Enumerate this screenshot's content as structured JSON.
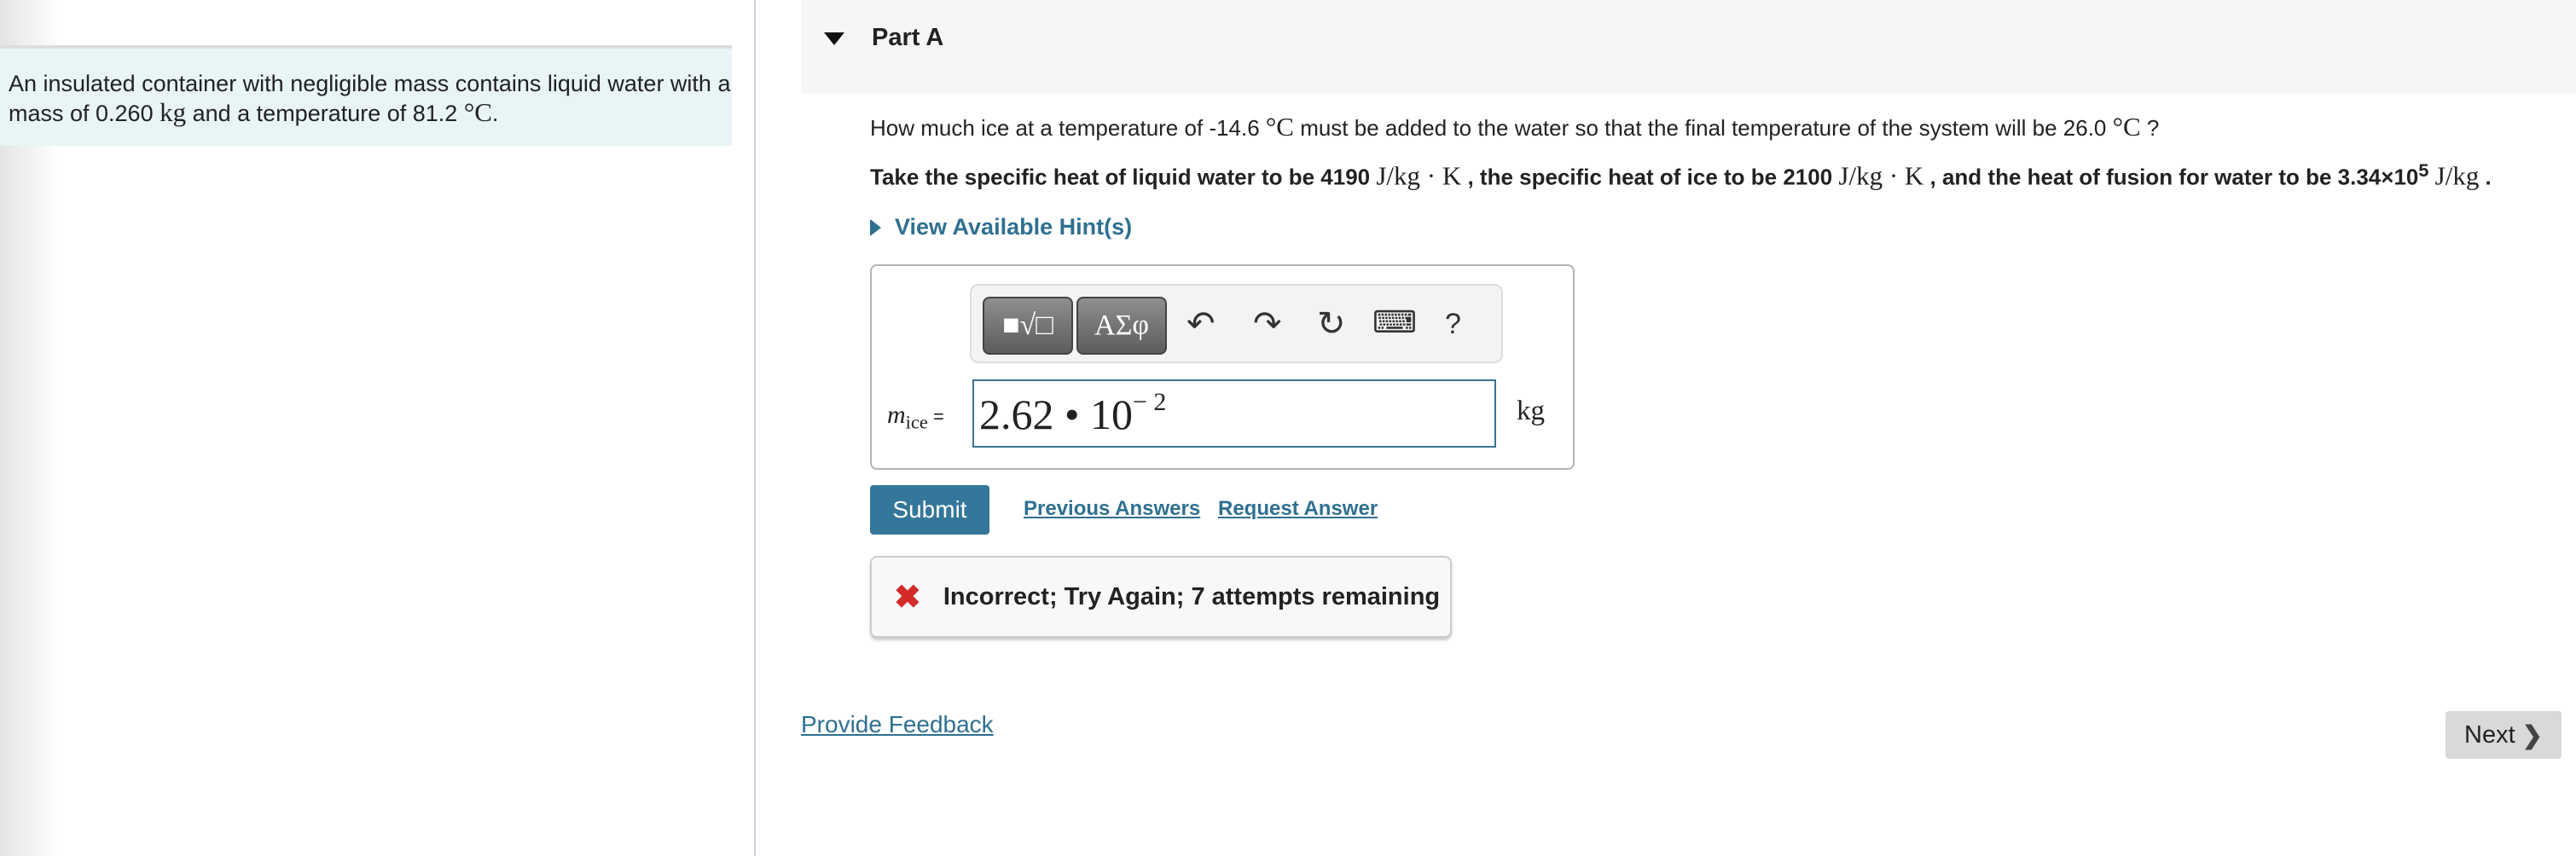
{
  "intro": {
    "text_a": "An insulated container with negligible mass contains liquid water with a mass of 0.260 ",
    "unit_kg": "kg",
    "text_b": " and a temperature of 81.2 ",
    "unit_c": "°C",
    "text_c": "."
  },
  "part": {
    "title": "Part A"
  },
  "question": {
    "line1_a": "How much ice at a temperature of -14.6 ",
    "line1_unit": "°C",
    "line1_b": " must be added to the water so that the final temperature of the system will be 26.0 ",
    "line1_unit2": "°C",
    "line1_c": " ?",
    "line2_a": "Take the specific heat of liquid water to be 4190 ",
    "unit_jkgk": "J/kg · K",
    "line2_b": " , the specific heat of ice to be 2100 ",
    "line2_c": " , and the heat of fusion for water to be 3.34×10",
    "line2_exp": "5",
    "unit_jkg": "J/kg",
    "line2_d": " ."
  },
  "hints": {
    "label": "View Available Hint(s)"
  },
  "toolbar": {
    "templates": "■√□",
    "greek": "ΑΣφ",
    "undo": "↶",
    "redo": "↷",
    "reset": "↻",
    "keyboard": "⌨",
    "help": "?"
  },
  "answer": {
    "label_var": "m",
    "label_sub": "ice",
    "label_eq": " =",
    "value_mantissa": "2.62 • 10",
    "value_exp": "− 2",
    "unit": "kg"
  },
  "actions": {
    "submit": "Submit",
    "previous": "Previous Answers",
    "request": "Request Answer"
  },
  "feedback": {
    "icon": "✖",
    "message": "Incorrect; Try Again; 7 attempts remaining",
    "color": "#d32a2a"
  },
  "footer": {
    "provide_feedback": "Provide Feedback",
    "next": "Next",
    "next_icon": "❯"
  }
}
